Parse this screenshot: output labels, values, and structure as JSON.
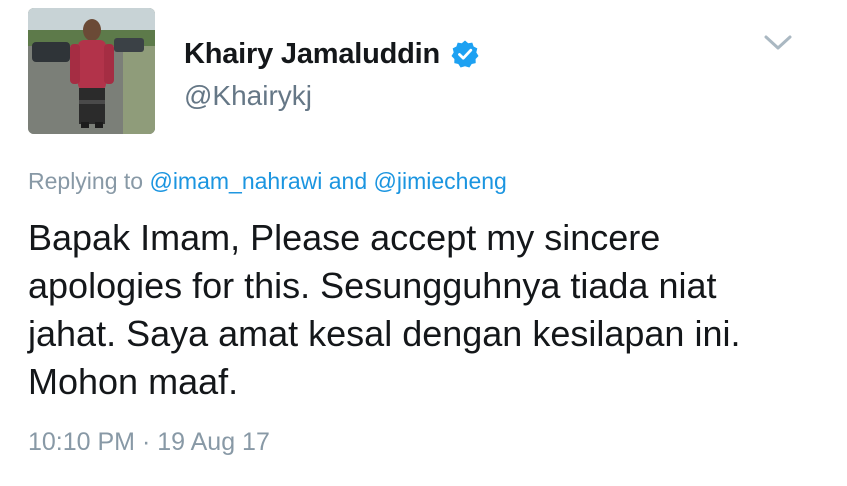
{
  "author": {
    "display_name": "Khairy Jamaluddin",
    "handle": "@Khairykj",
    "verified": true,
    "avatar_icon": "profile-photo",
    "verified_icon": "verified-badge-icon",
    "verified_color": "#1da1f2"
  },
  "reply_context": {
    "prefix": "Replying to",
    "mention_1": "@imam_nahrawi",
    "conjunction": "and",
    "mention_2": "@jimiecheng"
  },
  "tweet": {
    "lines": [
      "Bapak Imam, Please accept my sincere",
      "apologies for this. Sesungguhnya tiada niat",
      "jahat. Saya amat kesal dengan kesilapan ini.",
      "Mohon maaf."
    ],
    "time": "10:10 PM",
    "separator": "·",
    "date": "19 Aug 17"
  },
  "menu": {
    "icon": "chevron-down-icon"
  },
  "colors": {
    "text": "#14171a",
    "secondary": "#657786",
    "link": "#1b95e0",
    "meta": "#8899a6"
  }
}
